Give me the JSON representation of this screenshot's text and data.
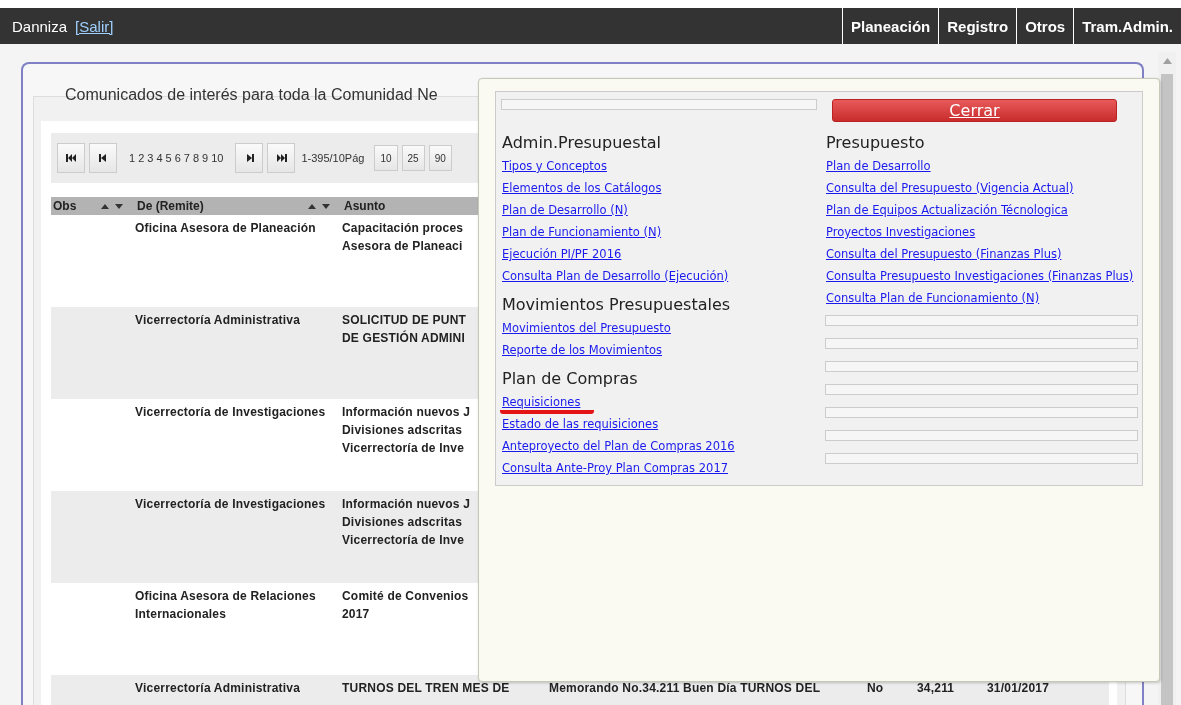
{
  "top_bar": {
    "user": "Danniza",
    "logout_link": "[Salir]",
    "menu": [
      {
        "label": "Planeación"
      },
      {
        "label": "Registro"
      },
      {
        "label": "Otros"
      },
      {
        "label": "Tram.Admin."
      }
    ]
  },
  "panel": {
    "title": "Comunicados de interés para toda la Comunidad Ne",
    "pager": {
      "pages": [
        "1",
        "2",
        "3",
        "4",
        "5",
        "6",
        "7",
        "8",
        "9",
        "10"
      ],
      "range": "1-395/10Pág",
      "page_sizes": [
        "10",
        "25",
        "90"
      ]
    },
    "table": {
      "columns": [
        "Obs",
        "De (Remite)",
        "Asunto"
      ],
      "rows": [
        {
          "de": "Oficina Asesora de Planeación",
          "asunto": [
            "Capacitación proces",
            "Asesora de Planeaci"
          ]
        },
        {
          "de": "Vicerrectoría Administrativa",
          "asunto": [
            "SOLICITUD DE PUNT",
            "DE GESTIÓN ADMINI"
          ]
        },
        {
          "de": "Vicerrectoría de Investigaciones",
          "asunto": [
            "Información nuevos J",
            "Divisiones adscritas",
            "Vicerrectoría de Inve"
          ]
        },
        {
          "de": "Vicerrectoría de Investigaciones",
          "asunto": [
            "Información nuevos J",
            "Divisiones adscritas",
            "Vicerrectoría de Inve"
          ]
        },
        {
          "de": "Oficina Asesora de Relaciones Internacionales",
          "asunto": [
            "Comité de Convenios",
            "2017"
          ]
        },
        {
          "de": "Vicerrectoría Administrativa",
          "asunto": [
            "TURNOS DEL TREN MES DE"
          ],
          "column_4": "Memorando No.34.211 Buen Día TURNOS DEL",
          "column_5": "No",
          "column_6": "34,211",
          "column_7": "31/01/2017"
        }
      ]
    }
  },
  "menu_popup": {
    "close_button": "Cerrar",
    "left_column": [
      {
        "heading": "Admin.Presupuestal",
        "links": [
          {
            "label": "Tipos y Conceptos",
            "marked": false
          },
          {
            "label": "Elementos de los Catálogos",
            "marked": false
          },
          {
            "label": "Plan de Desarrollo (N)",
            "marked": false
          },
          {
            "label": "Plan de Funcionamiento (N)",
            "marked": false
          },
          {
            "label": "Ejecución PI/PF 2016",
            "marked": false
          },
          {
            "label": "Consulta Plan de Desarrollo (Ejecución)",
            "marked": false
          }
        ]
      },
      {
        "heading": "Movimientos Presupuestales",
        "links": [
          {
            "label": "Movimientos del Presupuesto",
            "marked": false
          },
          {
            "label": "Reporte de los Movimientos",
            "marked": false
          }
        ]
      },
      {
        "heading": "Plan de Compras",
        "links": [
          {
            "label": "Requisiciones",
            "marked": true
          },
          {
            "label": "Estado de las requisiciones",
            "marked": false
          },
          {
            "label": "Anteproyecto del Plan de Compras 2016",
            "marked": false
          },
          {
            "label": "Consulta Ante-Proy Plan Compras 2017",
            "marked": false
          }
        ]
      }
    ],
    "right_column": [
      {
        "heading": "Presupuesto",
        "links": [
          {
            "label": "Plan de Desarrollo",
            "marked": false
          },
          {
            "label": "Consulta del Presupuesto (Vigencia Actual)",
            "marked": false
          },
          {
            "label": "Plan de Equipos Actualización Técnologica",
            "marked": false
          },
          {
            "label": "Proyectos Investigaciones",
            "marked": false
          },
          {
            "label": "Consulta del Presupuesto (Finanzas Plus)",
            "marked": false
          },
          {
            "label": "Consulta Presupuesto Investigaciones (Finanzas Plus)",
            "marked": false
          },
          {
            "label": "Consulta Plan de Funcionamiento (N)",
            "marked": false
          }
        ]
      }
    ]
  }
}
